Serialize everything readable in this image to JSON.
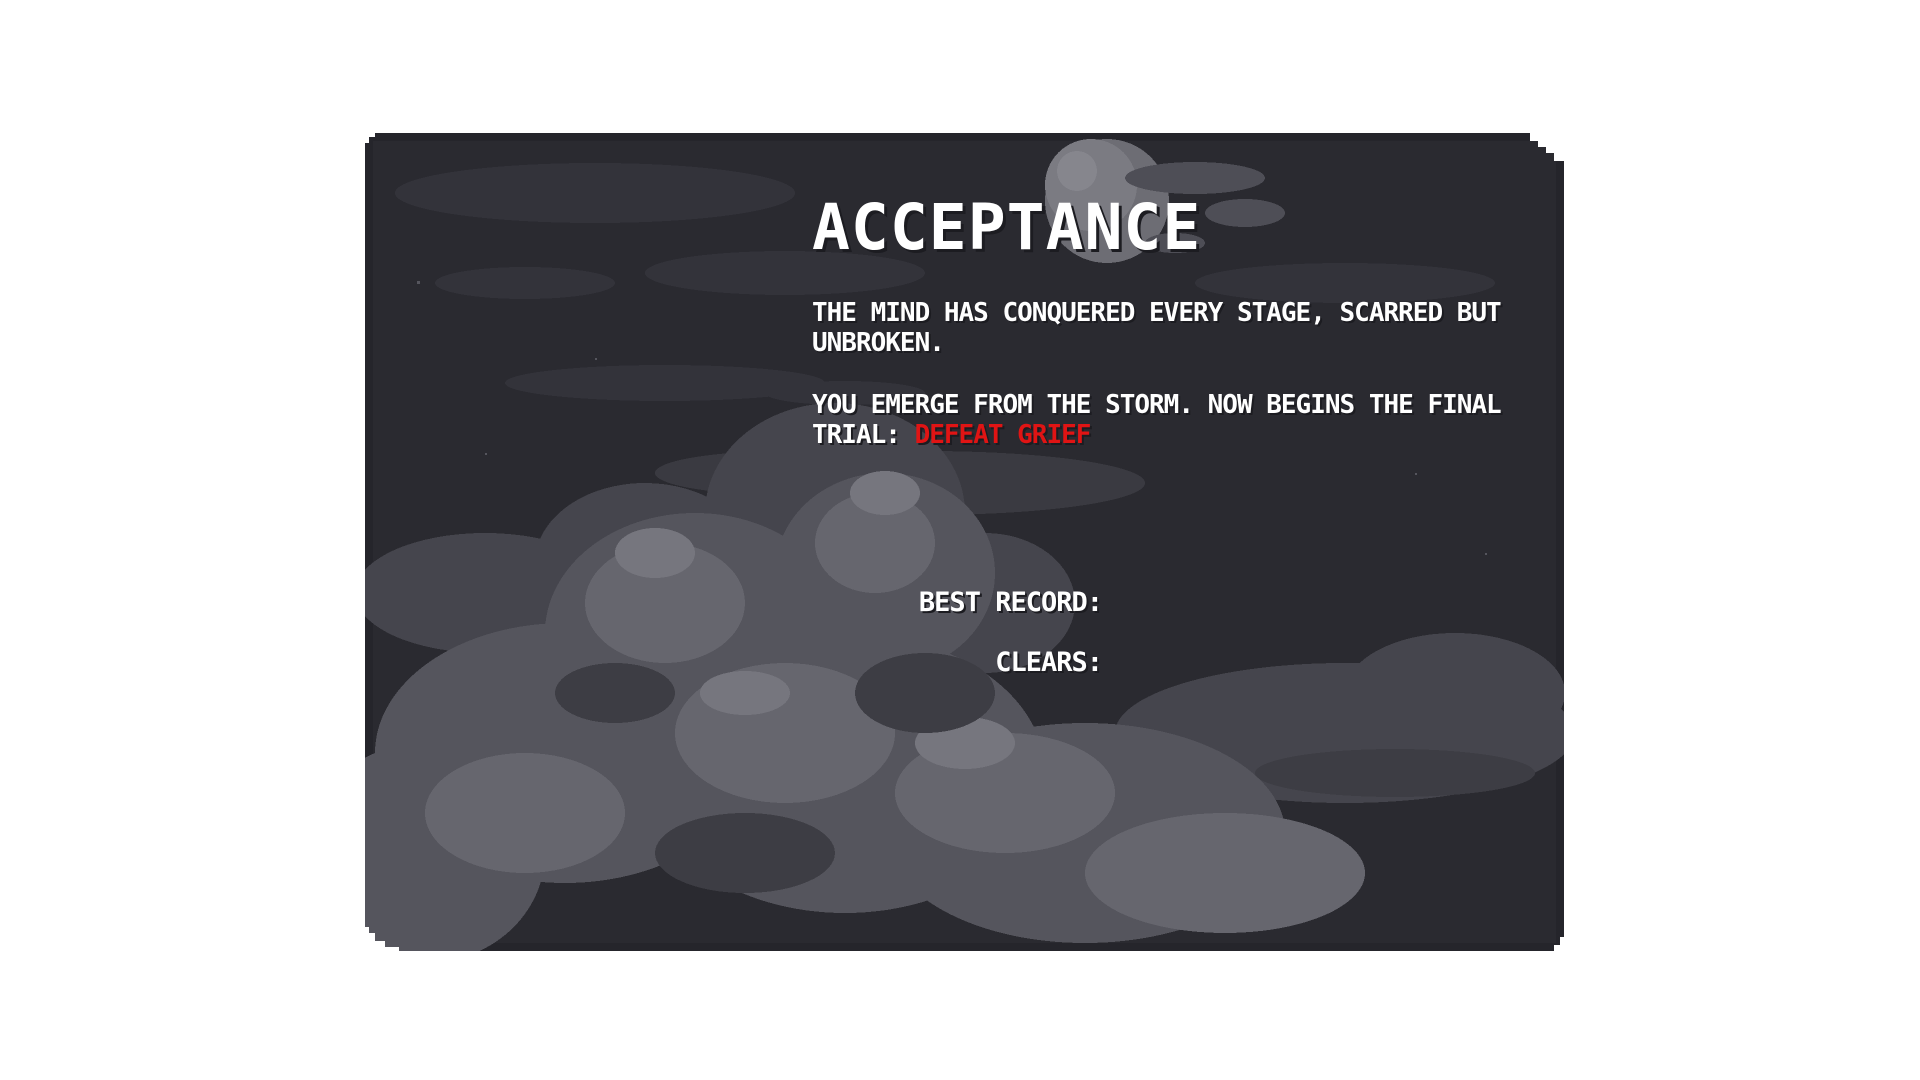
{
  "panel": {
    "title": "ACCEPTANCE",
    "description_line_1": "THE MIND HAS CONQUERED EVERY STAGE, SCARRED BUT UNBROKEN.",
    "description_line_2_prefix": "YOU EMERGE FROM THE STORM. NOW BEGINS THE FINAL TRIAL: ",
    "description_line_2_highlight": "DEFEAT GRIEF",
    "best_record_label": "BEST RECORD:",
    "clears_label": "CLEARS:"
  },
  "background": {
    "scene": "night sky with storm clouds and moon",
    "icons": [
      "moon-icon",
      "storm-clouds"
    ]
  },
  "colors": {
    "panel_bg": "#2a2a30",
    "text": "#ffffff",
    "highlight": "#e01414",
    "cloud_dark": "#4a4a52",
    "cloud_mid": "#5c5c64",
    "cloud_light": "#74747c",
    "moon": "#8a8a90"
  }
}
